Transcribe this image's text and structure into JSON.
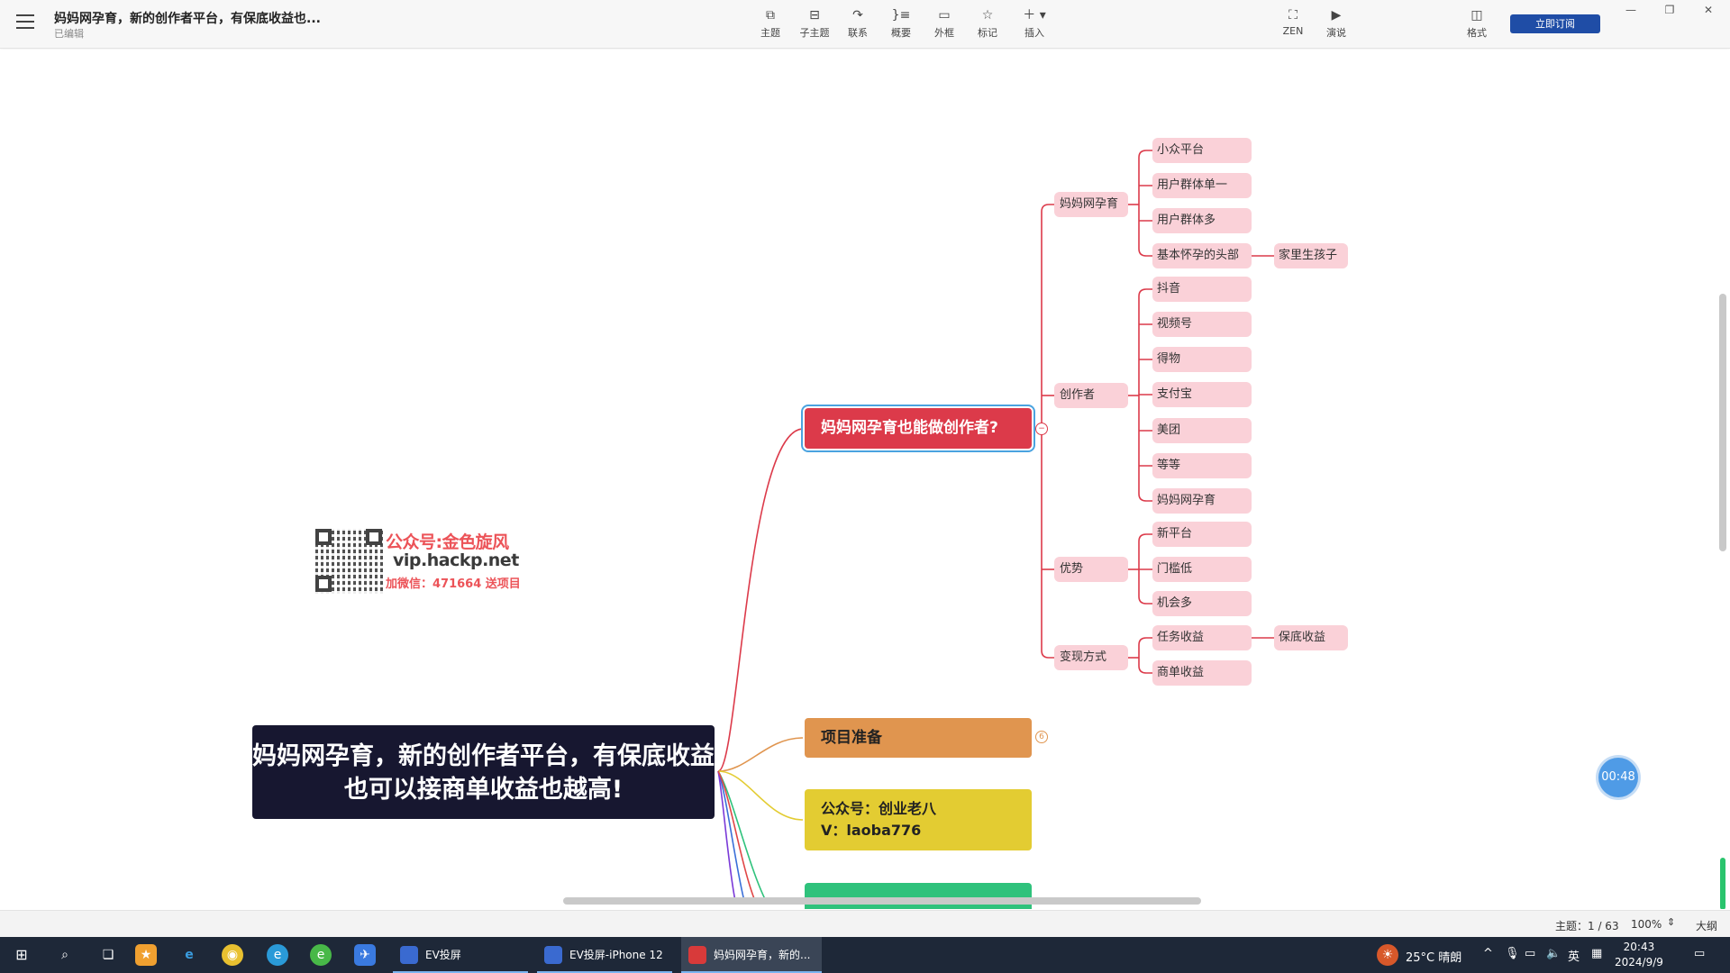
{
  "toolbar": {
    "doc_title": "妈妈网孕育，新的创作者平台，有保底收益也...",
    "doc_status": "已编辑",
    "tools": [
      {
        "label": "主题",
        "icon": "topic-icon"
      },
      {
        "label": "子主题",
        "icon": "subtopic-icon"
      },
      {
        "label": "联系",
        "icon": "relationship-icon"
      },
      {
        "label": "概要",
        "icon": "summary-icon"
      },
      {
        "label": "外框",
        "icon": "boundary-icon"
      },
      {
        "label": "标记",
        "icon": "star-icon"
      },
      {
        "label": "插入",
        "icon": "plus-icon"
      }
    ],
    "zen_label": "ZEN",
    "present_label": "演说",
    "format_label": "格式",
    "subscribe_label": "立即订阅"
  },
  "mindmap": {
    "root": "妈妈网孕育，新的创作者平台，有保底收益也可以接商单收益也越高!",
    "main_topic": "妈妈网孕育也能做创作者?",
    "branches": [
      {
        "label": "妈妈网孕育",
        "children": [
          "小众平台",
          "用户群体单一",
          "用户群体多",
          "基本怀孕的头部"
        ],
        "extra": "家里生孩子"
      },
      {
        "label": "创作者",
        "children": [
          "抖音",
          "视频号",
          "得物",
          "支付宝",
          "美团",
          "等等",
          "妈妈网孕育"
        ]
      },
      {
        "label": "优势",
        "children": [
          "新平台",
          "门槛低",
          "机会多"
        ]
      },
      {
        "label": "变现方式",
        "children": [
          "任务收益",
          "商单收益"
        ],
        "extra": "保底收益"
      }
    ],
    "prep_topic": "项目准备",
    "prep_collapsed_count": "6",
    "contact_line1": "公众号：创业老八",
    "contact_line2": "V：laoba776"
  },
  "watermark": {
    "line1": "公众号:金色旋风",
    "line2": "vip.hackp.net",
    "line3": "加微信：471664 送项目"
  },
  "timer": "00:48",
  "statusbar": {
    "topics": "主题：1 / 63",
    "zoom": "100%",
    "outline": "大纲"
  },
  "taskbar": {
    "apps": [
      "EV投屏",
      "EV投屏-iPhone 12",
      "妈妈网孕育，新的..."
    ],
    "weather": "25°C  晴朗",
    "ime": "英",
    "time": "20:43",
    "date": "2024/9/9"
  },
  "colors": {
    "root_bg": "#171730",
    "main_topic": "#dc3a4a",
    "leaf": "#fad1d8",
    "prep": "#e0954f",
    "contact": "#e3cc32",
    "green": "#2fc27c",
    "accent": "#1f4da6"
  }
}
